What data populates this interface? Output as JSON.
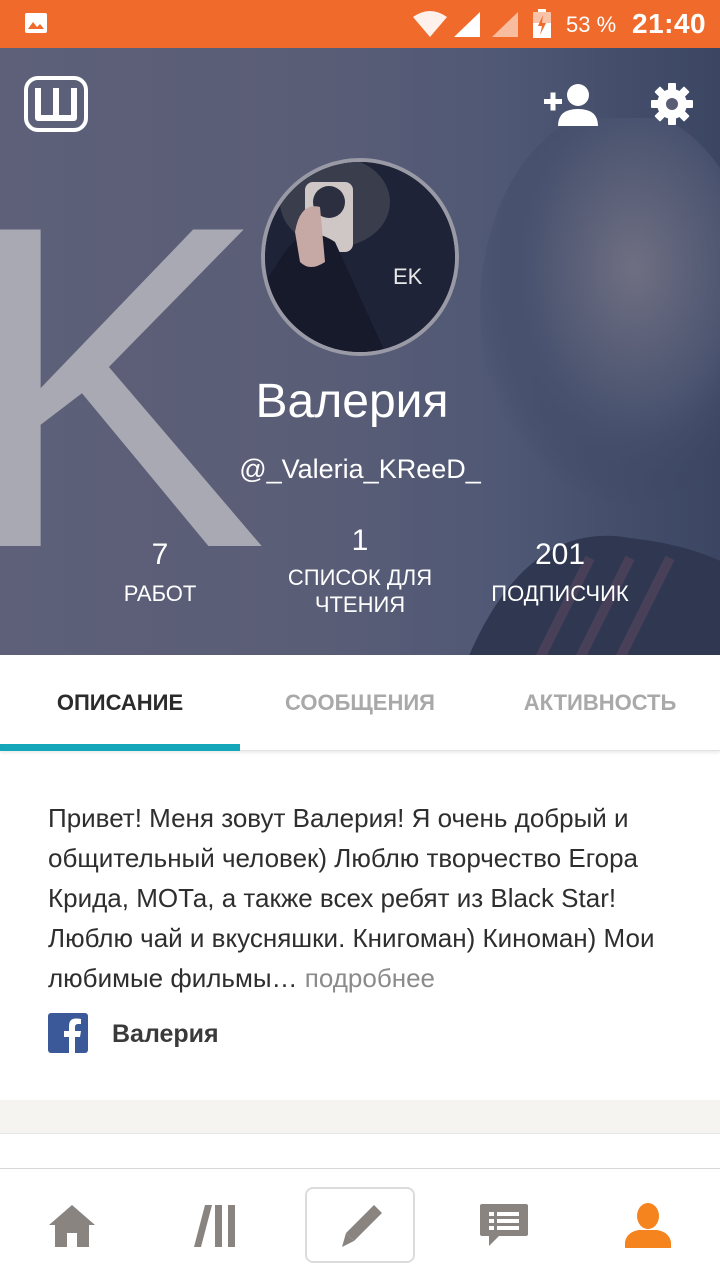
{
  "status_bar": {
    "battery_percent": "53 %",
    "time": "21:40",
    "background_color": "#f06a2b",
    "icons": [
      "gallery-icon",
      "wifi-icon",
      "signal-icon",
      "signal-icon",
      "battery-charging-icon"
    ]
  },
  "header": {
    "app_logo": "Ш",
    "icons": [
      "app-logo-icon",
      "add-friend-icon",
      "settings-gear-icon"
    ]
  },
  "profile": {
    "name": "Валерия",
    "username": "@_Valeria_KReeD_",
    "avatar_text": "EK",
    "stats": {
      "works": {
        "value": "7",
        "label": "РАБОТ"
      },
      "reading_lists": {
        "value": "1",
        "label_line1": "СПИСОК ДЛЯ",
        "label_line2": "ЧТЕНИЯ"
      },
      "followers": {
        "value": "201",
        "label": "ПОДПИСЧИК"
      }
    }
  },
  "tabs": [
    {
      "label": "ОПИСАНИЕ",
      "active": true
    },
    {
      "label": "СООБЩЕНИЯ",
      "active": false
    },
    {
      "label": "АКТИВНОСТЬ",
      "active": false
    }
  ],
  "tab_indicator_color": "#14a6b9",
  "about": {
    "text": "Привет! Меня зовут Валерия! Я очень добрый и общительный человек) Люблю творчество Егора Крида, МОТа, а также всех ребят из Black Star! Люблю чай и вкусняшки. Книгоман) Киноман) Мои любимые фильмы…",
    "more_link": "подробнее",
    "facebook_name": "Валерия"
  },
  "bottom_nav": {
    "items": [
      "home-icon",
      "library-icon",
      "write-icon",
      "messages-icon",
      "profile-icon"
    ],
    "active_color": "#f5841f",
    "inactive_color": "#8a8480"
  }
}
